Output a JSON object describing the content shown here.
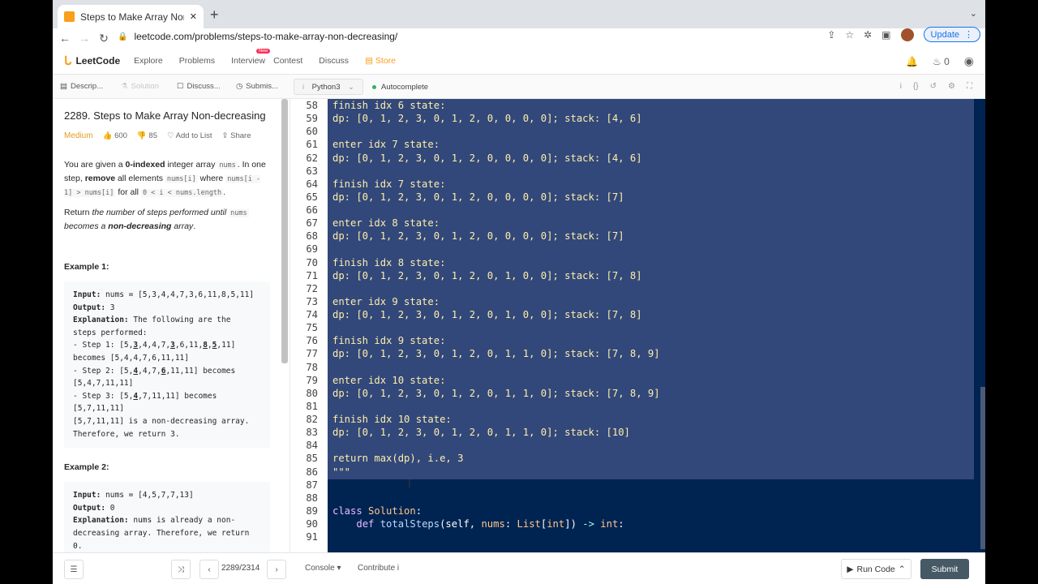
{
  "browser": {
    "tab_title": "Steps to Make Array Non-decr",
    "new_tab": "+",
    "url": "leetcode.com/problems/steps-to-make-array-non-decreasing/",
    "update_label": "Update"
  },
  "nav": {
    "brand": "LeetCode",
    "items": [
      "Explore",
      "Problems",
      "Interview",
      "Contest",
      "Discuss",
      "Store"
    ],
    "new_badge": "New",
    "fire_count": "0"
  },
  "left_tabs": [
    "Descrip...",
    "Solution",
    "Discuss...",
    "Submis..."
  ],
  "editor_bar": {
    "language": "Python3",
    "autocomplete": "Autocomplete"
  },
  "problem": {
    "title": "2289. Steps to Make Array Non-decreasing",
    "difficulty": "Medium",
    "likes": "600",
    "dislikes": "85",
    "add_to_list": "Add to List",
    "share": "Share",
    "p1_a": "You are given a ",
    "p1_b": "0-indexed",
    "p1_c": " integer array ",
    "p1_d": "nums",
    "p1_e": ". In one step, ",
    "p1_f": "remove",
    "p1_g": " all elements ",
    "p1_h": "nums[i]",
    "p1_i": " where ",
    "p1_j": "nums[i - 1] > nums[i]",
    "p1_k": " for all ",
    "p1_l": "0 < i < nums.length",
    "p1_m": ".",
    "p2_a": "Return ",
    "p2_b": "the number of steps performed until ",
    "p2_c": "nums",
    "p2_d": " becomes a ",
    "p2_e": "non-decreasing",
    "p2_f": " array",
    "p2_g": ".",
    "example1_title": "Example 1:",
    "example2_title": "Example 2:",
    "ex1": {
      "input_label": "Input:",
      "input": " nums = [5,3,4,4,7,3,6,11,8,5,11]",
      "output_label": "Output:",
      "output": " 3",
      "expl_label": "Explanation:",
      "expl": " The following are the",
      "l2": "steps performed:",
      "s1a": "- Step 1: [5,",
      "s1b": "3",
      "s1c": ",4,4,7,",
      "s1d": "3",
      "s1e": ",6,11,",
      "s1f": "8",
      "s1g": ",",
      "s1h": "5",
      "s1i": ",11]",
      "l4": "becomes [5,4,4,7,6,11,11]",
      "s2a": "- Step 2: [5,",
      "s2b": "4",
      "s2c": ",4,7,",
      "s2d": "6",
      "s2e": ",11,11] becomes",
      "l6": "[5,4,7,11,11]",
      "s3a": "- Step 3: [5,",
      "s3b": "4",
      "s3c": ",7,11,11] becomes",
      "l8": "[5,7,11,11]",
      "l9": "[5,7,11,11] is a non-decreasing array.",
      "l10": "Therefore, we return 3."
    },
    "ex2": {
      "input_label": "Input:",
      "input": " nums = [4,5,7,7,13]",
      "output_label": "Output:",
      "output": " 0",
      "expl_label": "Explanation:",
      "expl": " nums is already a non-",
      "l2": "decreasing array. Therefore, we return",
      "l3": "0."
    }
  },
  "code": {
    "line_numbers": [
      "58",
      "59",
      "60",
      "61",
      "62",
      "63",
      "64",
      "65",
      "66",
      "67",
      "68",
      "69",
      "70",
      "71",
      "72",
      "73",
      "74",
      "75",
      "76",
      "77",
      "78",
      "79",
      "80",
      "81",
      "82",
      "83",
      "84",
      "85",
      "86",
      "87",
      "88",
      "89",
      "90",
      "91"
    ],
    "lines": [
      "finish idx 6 state:",
      "dp: [0, 1, 2, 3, 0, 1, 2, 0, 0, 0, 0]; stack: [4, 6]",
      "",
      "enter idx 7 state:",
      "dp: [0, 1, 2, 3, 0, 1, 2, 0, 0, 0, 0]; stack: [4, 6]",
      "",
      "finish idx 7 state:",
      "dp: [0, 1, 2, 3, 0, 1, 2, 0, 0, 0, 0]; stack: [7]",
      "",
      "enter idx 8 state:",
      "dp: [0, 1, 2, 3, 0, 1, 2, 0, 0, 0, 0]; stack: [7]",
      "",
      "finish idx 8 state:",
      "dp: [0, 1, 2, 3, 0, 1, 2, 0, 1, 0, 0]; stack: [7, 8]",
      "",
      "enter idx 9 state:",
      "dp: [0, 1, 2, 3, 0, 1, 2, 0, 1, 0, 0]; stack: [7, 8]",
      "",
      "finish idx 9 state:",
      "dp: [0, 1, 2, 3, 0, 1, 2, 0, 1, 1, 0]; stack: [7, 8, 9]",
      "",
      "enter idx 10 state:",
      "dp: [0, 1, 2, 3, 0, 1, 2, 0, 1, 1, 0]; stack: [7, 8, 9]",
      "",
      "finish idx 10 state:",
      "dp: [0, 1, 2, 3, 0, 1, 2, 0, 1, 1, 0]; stack: [10]",
      "",
      "return max(dp), i.e, 3",
      "\"\"\"",
      "",
      ""
    ],
    "class_kw": "class",
    "class_name": "Solution",
    "class_colon": ":",
    "def_kw": "def",
    "fn_name": "totalSteps",
    "sig_a": "(self, ",
    "sig_b": "nums",
    "sig_c": ": ",
    "sig_d": "List",
    "sig_e": "[",
    "sig_f": "int",
    "sig_g": "]) ",
    "sig_h": "->",
    "sig_i": " ",
    "sig_j": "int",
    "sig_k": ":"
  },
  "bottom": {
    "pager": "2289/2314",
    "console": "Console",
    "contribute": "Contribute",
    "run_code": "Run Code",
    "submit": "Submit"
  }
}
